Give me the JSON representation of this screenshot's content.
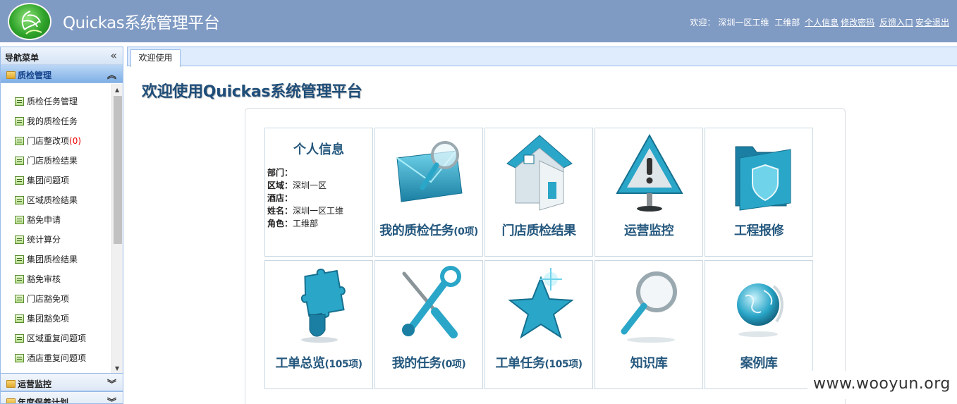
{
  "header": {
    "title": "Quickas系统管理平台",
    "welcome": "欢迎：",
    "user": "深圳一区工维",
    "dept": "工维部",
    "links": [
      "个人信息",
      "修改密码",
      "反馈入口",
      "安全退出"
    ]
  },
  "sidebar": {
    "title": "导航菜单",
    "collapse_icon": "«",
    "active_panel": "质检管理",
    "items": [
      {
        "label": "质检任务管理"
      },
      {
        "label": "我的质检任务"
      },
      {
        "label": "门店整改项",
        "count": "(0)"
      },
      {
        "label": "门店质检结果"
      },
      {
        "label": "集团问题项"
      },
      {
        "label": "区域质检结果"
      },
      {
        "label": "豁免申请"
      },
      {
        "label": "统计算分"
      },
      {
        "label": "集团质检结果"
      },
      {
        "label": "豁免审核"
      },
      {
        "label": "门店豁免项"
      },
      {
        "label": "集团豁免项"
      },
      {
        "label": "区域重复问题项"
      },
      {
        "label": "酒店重复问题项"
      }
    ],
    "panels": [
      "运营监控",
      "年度保养计划"
    ]
  },
  "main": {
    "tab": "欢迎使用",
    "page_title": "欢迎使用Quickas系统管理平台",
    "info": {
      "title": "个人信息",
      "rows": [
        {
          "k": "部门：",
          "v": ""
        },
        {
          "k": "区域：",
          "v": "深圳一区"
        },
        {
          "k": "酒店：",
          "v": ""
        },
        {
          "k": "姓名：",
          "v": "深圳一区工维"
        },
        {
          "k": "角色：",
          "v": "工维部"
        }
      ]
    },
    "tiles": [
      {
        "label": "我的质检任务",
        "suffix": "(0项)",
        "icon": "envelope-magnifier-icon"
      },
      {
        "label": "门店质检结果",
        "suffix": "",
        "icon": "house-icon"
      },
      {
        "label": "运营监控",
        "suffix": "",
        "icon": "warning-icon"
      },
      {
        "label": "工程报修",
        "suffix": "",
        "icon": "folder-shield-icon"
      },
      {
        "label": "工单总览",
        "suffix": "(105项)",
        "icon": "puzzle-icon"
      },
      {
        "label": "我的任务",
        "suffix": "(0项)",
        "icon": "tools-icon"
      },
      {
        "label": "工单任务",
        "suffix": "(105项)",
        "icon": "star-icon"
      },
      {
        "label": "知识库",
        "suffix": "",
        "icon": "magnifier-icon"
      },
      {
        "label": "案例库",
        "suffix": "",
        "icon": "globe-icon"
      }
    ]
  },
  "watermark": "www.wooyun.org",
  "colors": {
    "header": "#7f9ac3",
    "accent": "#25587e",
    "teal": "#2aa6c8"
  }
}
